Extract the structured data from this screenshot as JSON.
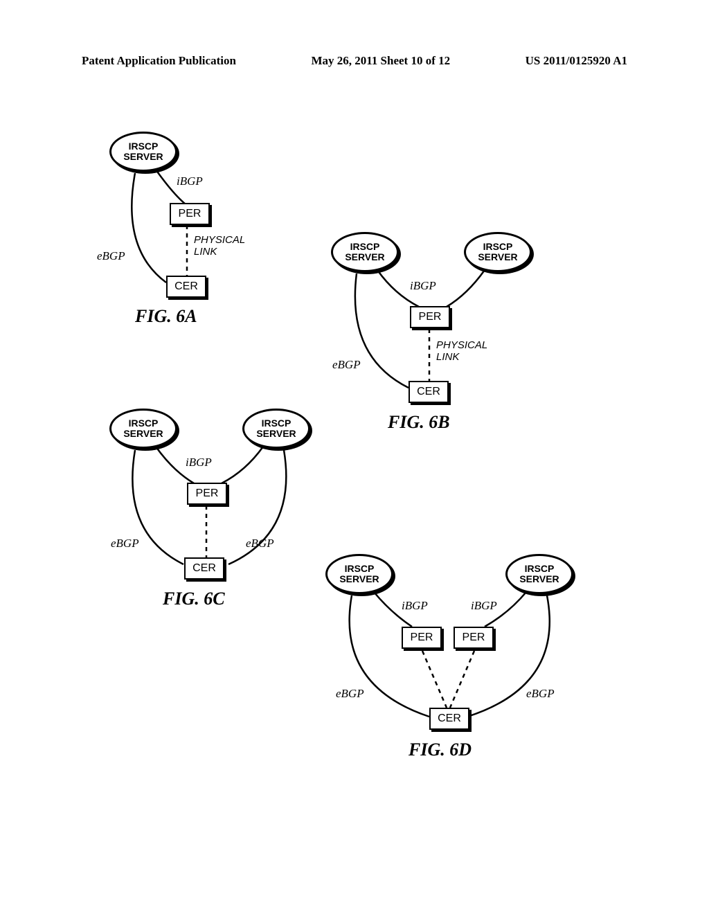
{
  "header": {
    "left": "Patent Application Publication",
    "center": "May 26, 2011  Sheet 10 of 12",
    "right": "US 2011/0125920 A1"
  },
  "labels": {
    "irscp": "IRSCP\nSERVER",
    "per": "PER",
    "cer": "CER",
    "ibgp": "iBGP",
    "ebgp": "eBGP",
    "physical_link": "PHYSICAL\nLINK"
  },
  "figs": {
    "a": "FIG. 6A",
    "b": "FIG. 6B",
    "c": "FIG. 6C",
    "d": "FIG. 6D"
  }
}
